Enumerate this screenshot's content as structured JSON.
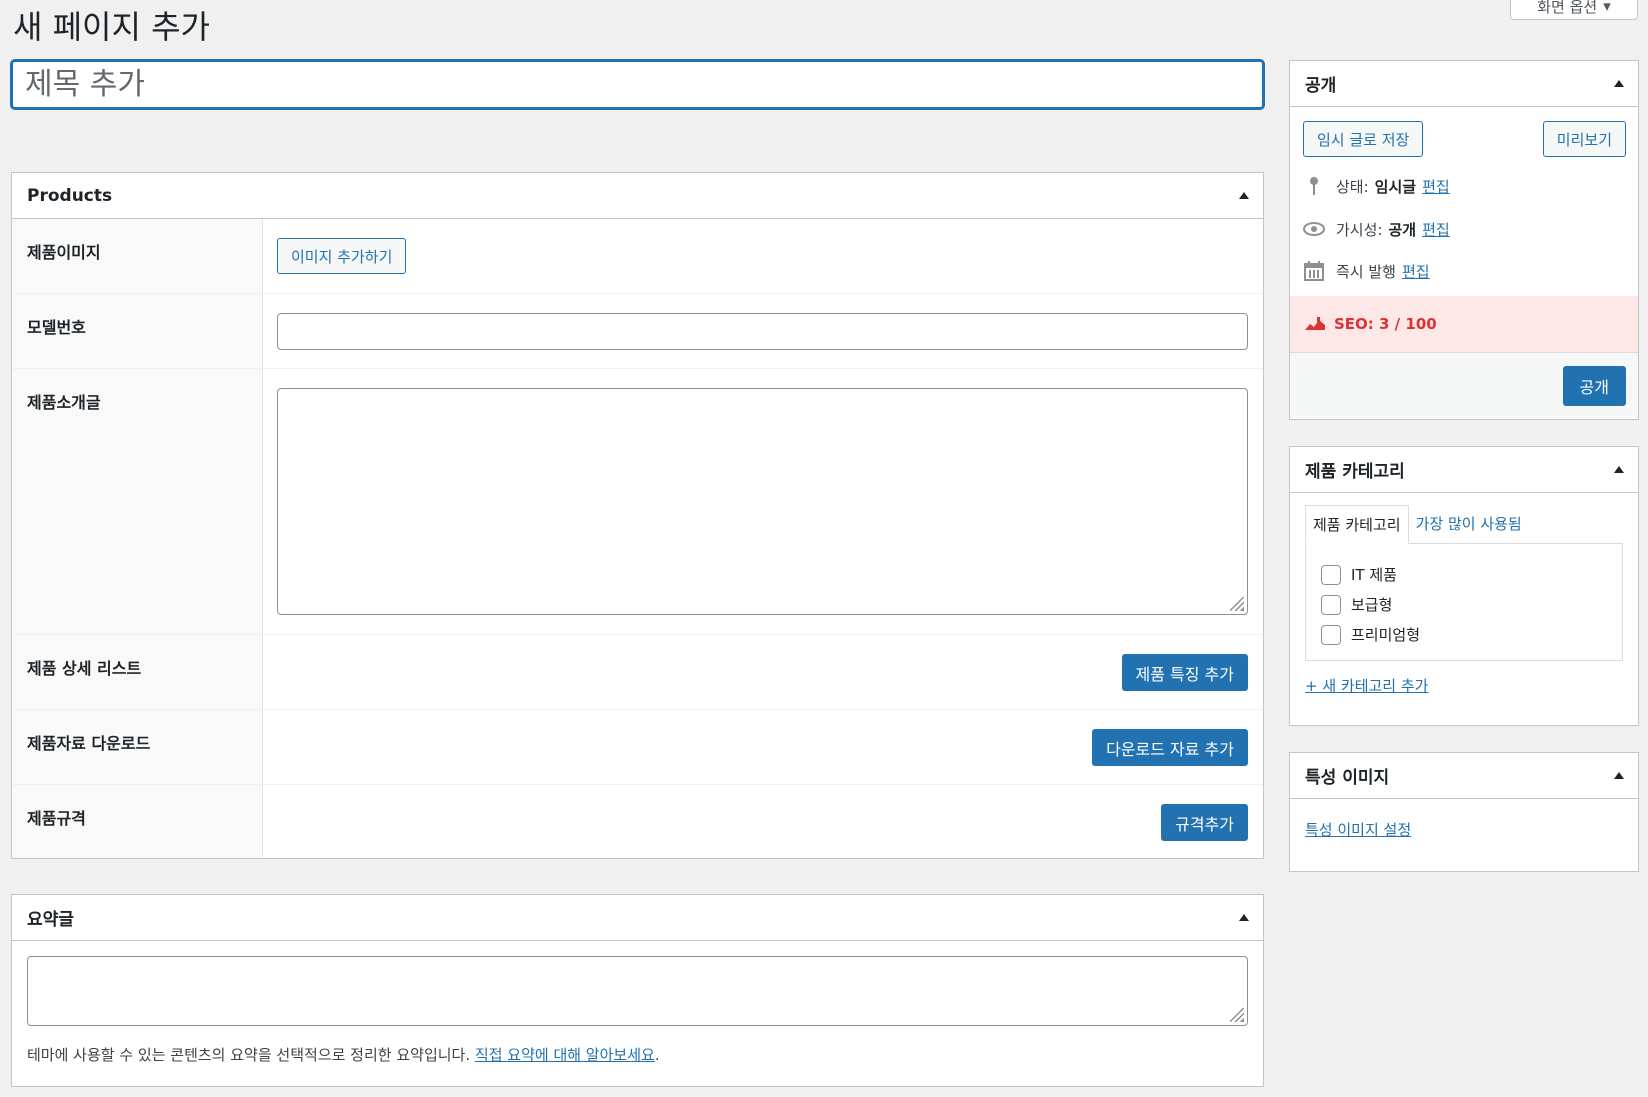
{
  "page": {
    "title": "새 페이지 추가",
    "screen_options": "화면 옵션",
    "title_placeholder": "제목 추가"
  },
  "products": {
    "heading": "Products",
    "rows": {
      "image_label": "제품이미지",
      "image_button": "이미지 추가하기",
      "model_label": "모델번호",
      "model_value": "",
      "intro_label": "제품소개글",
      "intro_value": "",
      "detail_label": "제품 상세 리스트",
      "detail_button": "제품 특징 추가",
      "download_label": "제품자료 다운로드",
      "download_button": "다운로드 자료 추가",
      "spec_label": "제품규격",
      "spec_button": "규격추가"
    }
  },
  "excerpt": {
    "heading": "요약글",
    "value": "",
    "help_text": "테마에 사용할 수 있는 콘텐츠의 요약을 선택적으로 정리한 요약입니다.",
    "help_link": "직접 요약에 대해 알아보세요",
    "help_end": "."
  },
  "publish": {
    "heading": "공개",
    "save_draft": "임시 글로 저장",
    "preview": "미리보기",
    "status_label": "상태:",
    "status_value": "임시글",
    "visibility_label": "가시성:",
    "visibility_value": "공개",
    "schedule_label": "즉시 발행",
    "edit": "편집",
    "seo": "SEO: 3 / 100",
    "publish_button": "공개"
  },
  "categories": {
    "heading": "제품 카테고리",
    "tab_all": "제품 카테고리",
    "tab_popular": "가장 많이 사용됨",
    "items": [
      "IT 제품",
      "보급형",
      "프리미엄형"
    ],
    "add_new": "+ 새 카테고리 추가"
  },
  "featured": {
    "heading": "특성 이미지",
    "set_link": "특성 이미지 설정"
  },
  "colors": {
    "primary": "#2271b1",
    "seo_bg": "#fde7e7",
    "seo_text": "#dc3232"
  },
  "icons": [
    "pin-icon",
    "eye-icon",
    "calendar-icon",
    "seo-icon",
    "chevron-down-icon",
    "toggle-up-icon"
  ]
}
